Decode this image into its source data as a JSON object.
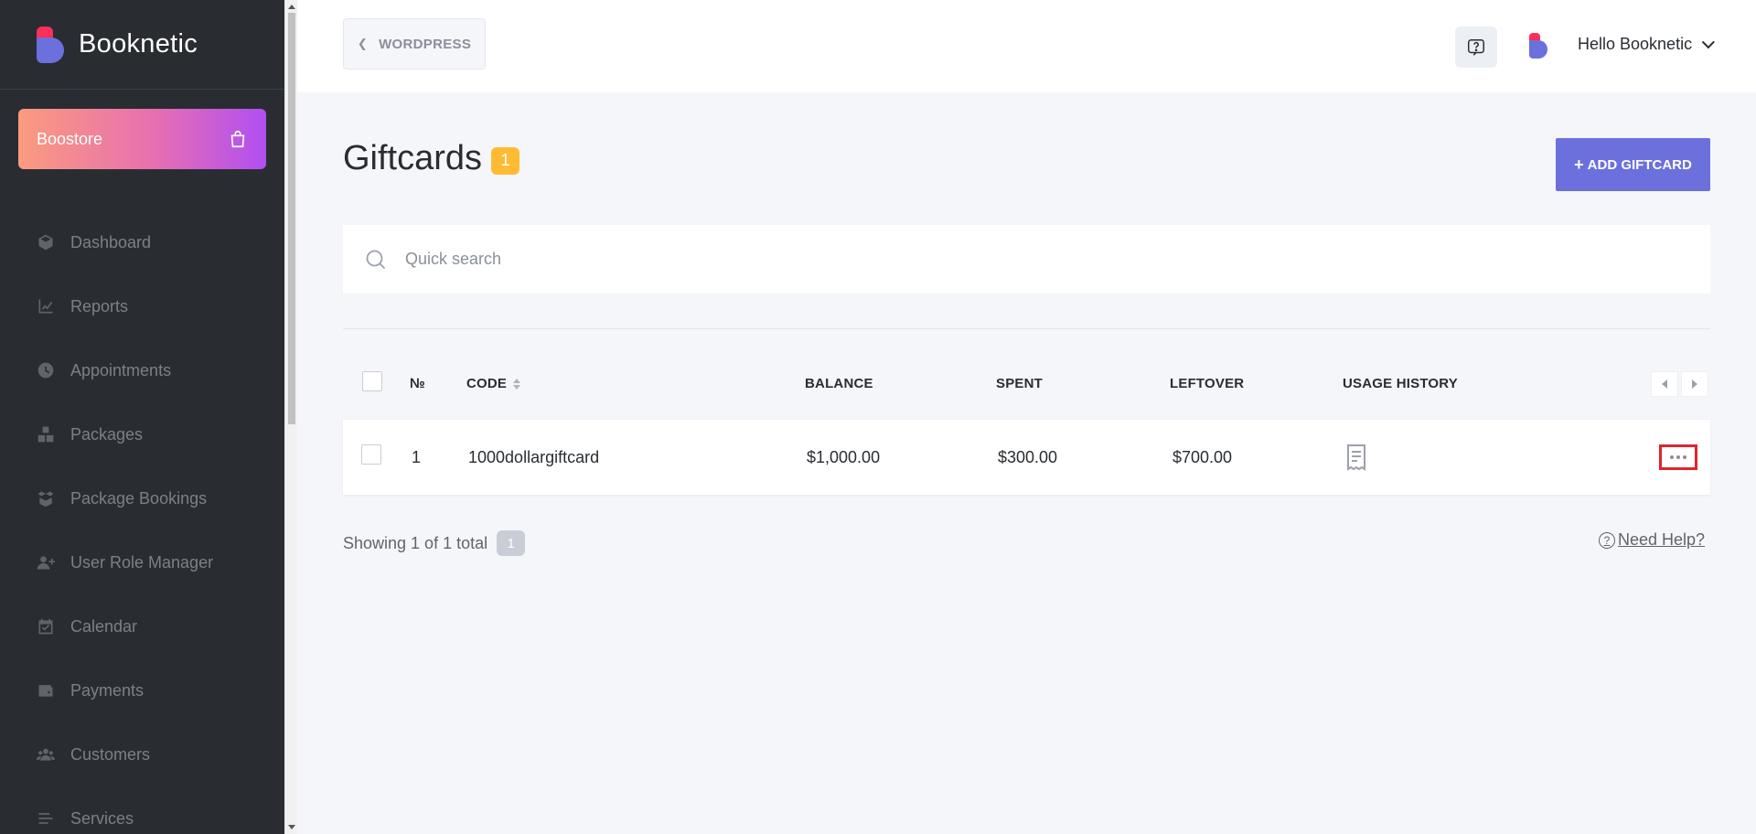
{
  "brand": {
    "name": "Booknetic"
  },
  "boostore": {
    "label": "Boostore"
  },
  "sidebar": {
    "items": [
      {
        "label": "Dashboard",
        "icon": "cube-icon"
      },
      {
        "label": "Reports",
        "icon": "chart-line-icon"
      },
      {
        "label": "Appointments",
        "icon": "clock-icon"
      },
      {
        "label": "Packages",
        "icon": "boxes-icon"
      },
      {
        "label": "Package Bookings",
        "icon": "box-open-icon"
      },
      {
        "label": "User Role Manager",
        "icon": "user-plus-icon"
      },
      {
        "label": "Calendar",
        "icon": "calendar-check-icon"
      },
      {
        "label": "Payments",
        "icon": "wallet-icon"
      },
      {
        "label": "Customers",
        "icon": "users-icon"
      },
      {
        "label": "Services",
        "icon": "list-icon"
      }
    ]
  },
  "header": {
    "back_label": "WORDPRESS",
    "user_greeting": "Hello Booknetic"
  },
  "page": {
    "title": "Giftcards",
    "count": "1",
    "add_button": "ADD GIFTCARD",
    "search_placeholder": "Quick search"
  },
  "table": {
    "headers": {
      "num": "№",
      "code": "CODE",
      "balance": "BALANCE",
      "spent": "SPENT",
      "leftover": "LEFTOVER",
      "usage": "USAGE HISTORY"
    },
    "rows": [
      {
        "num": "1",
        "code": "1000dollargiftcard",
        "balance": "$1,000.00",
        "spent": "$300.00",
        "leftover": "$700.00"
      }
    ]
  },
  "footer": {
    "showing": "Showing 1 of 1 total",
    "page": "1",
    "help": "Need Help?"
  },
  "colors": {
    "sidebar_bg": "#292d32",
    "accent": "#6c70dc",
    "badge": "#ffbb33",
    "highlight": "#e0252f"
  }
}
